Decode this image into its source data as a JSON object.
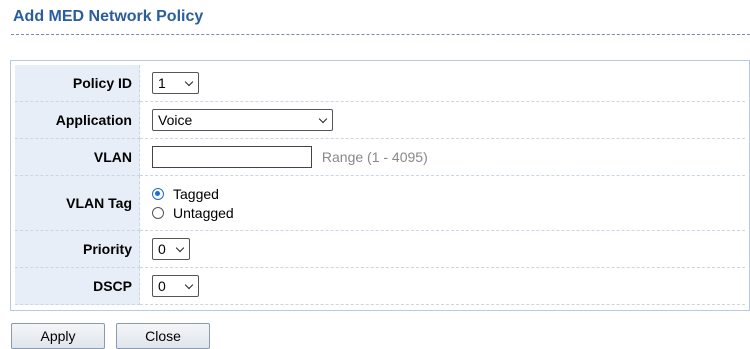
{
  "page": {
    "title": "Add MED Network Policy"
  },
  "form": {
    "policy_id": {
      "label": "Policy ID",
      "value": "1"
    },
    "application": {
      "label": "Application",
      "value": "Voice"
    },
    "vlan": {
      "label": "VLAN",
      "value": "",
      "hint": "Range (1 - 4095)"
    },
    "vlan_tag": {
      "label": "VLAN Tag",
      "options": [
        {
          "label": "Tagged",
          "selected": true
        },
        {
          "label": "Untagged",
          "selected": false
        }
      ]
    },
    "priority": {
      "label": "Priority",
      "value": "0"
    },
    "dscp": {
      "label": "DSCP",
      "value": "0"
    }
  },
  "buttons": {
    "apply": "Apply",
    "close": "Close"
  },
  "colors": {
    "title": "#2a5d9f",
    "label_bg": "#e8eef8",
    "radio_accent": "#1a6fd6"
  }
}
